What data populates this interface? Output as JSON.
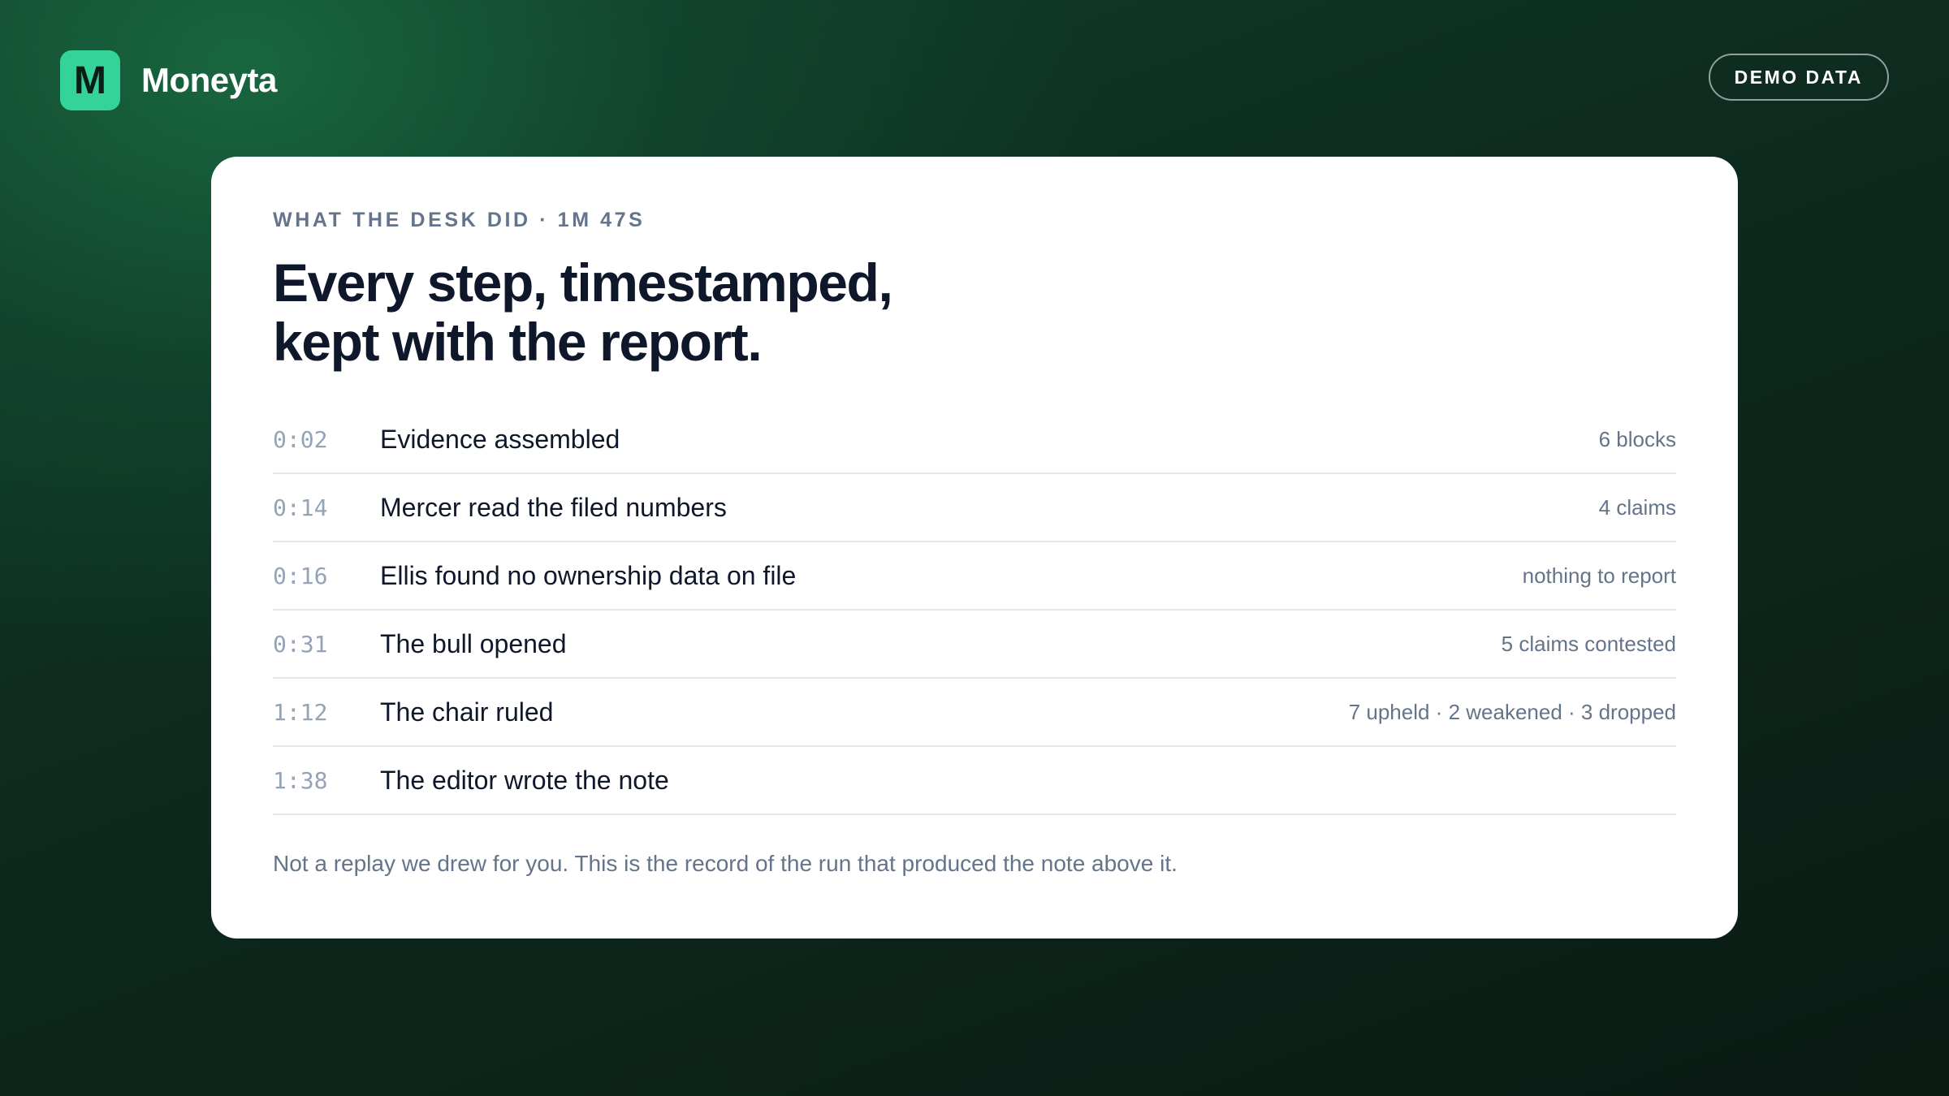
{
  "brand": {
    "logo_letter": "M",
    "name": "Moneyta",
    "accent_color": "#34d399"
  },
  "badge": {
    "label": "DEMO DATA"
  },
  "card": {
    "eyebrow": "WHAT THE DESK DID · 1M 47S",
    "headline_line1": "Every step, timestamped,",
    "headline_line2": "kept with the report.",
    "timeline": [
      {
        "time": "0:02",
        "step": "Evidence assembled",
        "meta": "6 blocks"
      },
      {
        "time": "0:14",
        "step": "Mercer read the filed numbers",
        "meta": "4 claims"
      },
      {
        "time": "0:16",
        "step": "Ellis found no ownership data on file",
        "meta": "nothing to report"
      },
      {
        "time": "0:31",
        "step": "The bull opened",
        "meta": "5 claims contested"
      },
      {
        "time": "1:12",
        "step": "The chair ruled",
        "meta": "7 upheld · 2 weakened · 3 dropped"
      },
      {
        "time": "1:38",
        "step": "The editor wrote the note",
        "meta": ""
      }
    ],
    "footnote": "Not a replay we drew for you. This is the record of the run that produced the note above it."
  }
}
